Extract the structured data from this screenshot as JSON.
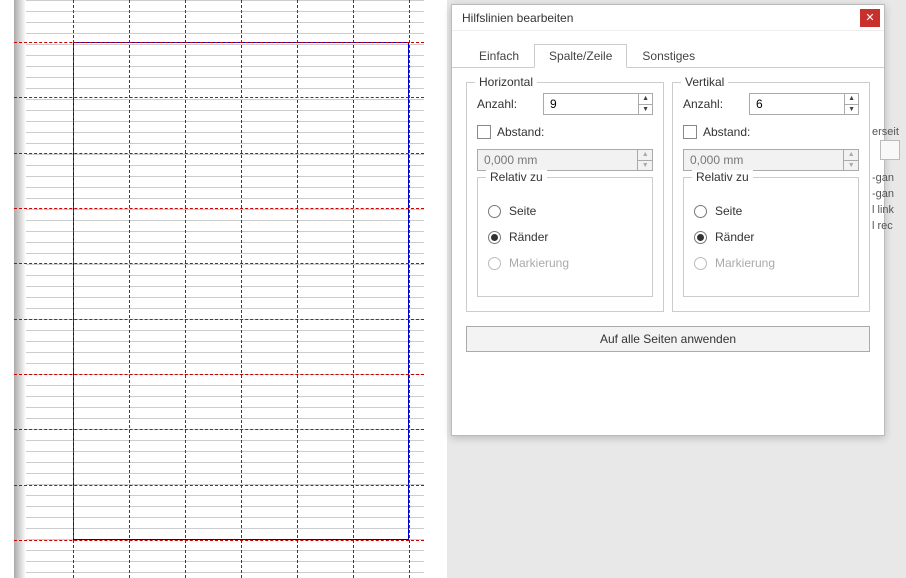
{
  "dialog": {
    "title": "Hilfslinien bearbeiten",
    "tabs": {
      "simple": "Einfach",
      "column_row": "Spalte/Zeile",
      "other": "Sonstiges"
    },
    "horizontal": {
      "legend": "Horizontal",
      "count_label": "Anzahl:",
      "count_value": "9",
      "spacing_label": "Abstand:",
      "spacing_value": "0,000 mm",
      "relative_legend": "Relativ zu",
      "opt_page": "Seite",
      "opt_margins": "Ränder",
      "opt_selection": "Markierung",
      "selected": "margins"
    },
    "vertical": {
      "legend": "Vertikal",
      "count_label": "Anzahl:",
      "count_value": "6",
      "spacing_label": "Abstand:",
      "spacing_value": "0,000 mm",
      "relative_legend": "Relativ zu",
      "opt_page": "Seite",
      "opt_margins": "Ränder",
      "opt_selection": "Markierung",
      "selected": "margins"
    },
    "apply_label": "Auf alle Seiten anwenden"
  },
  "side_text": {
    "l1": "erseit",
    "l2": "-gan",
    "l3": "-gan",
    "l4": "l link",
    "l5": "l rec"
  },
  "chart_data": {
    "type": "table",
    "description": "Page preview showing guide lines grid",
    "horizontal_guides": 9,
    "vertical_guides": 6,
    "relative_to": "margins"
  }
}
